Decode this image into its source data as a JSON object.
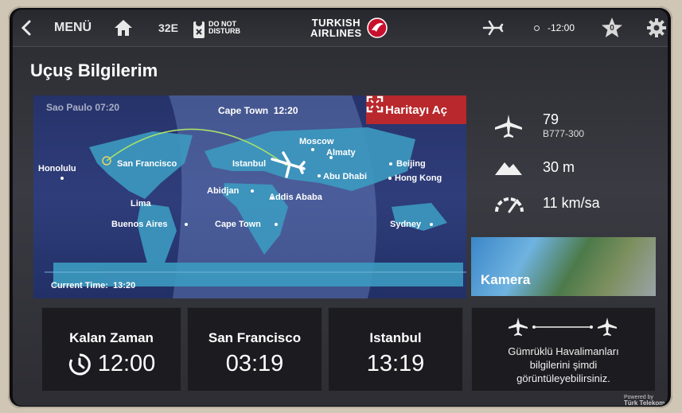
{
  "header": {
    "back_icon": "chevron-left-icon",
    "menu_label": "MENÜ",
    "home_icon": "home-icon",
    "seat": "32E",
    "dnd_line1": "DO NOT",
    "dnd_line2": "DISTURB",
    "brand_line1": "TURKISH",
    "brand_line2": "AIRLINES",
    "flight_mode_icon": "airplane-icon",
    "time_offset": "-12:00",
    "favorites_count": "0",
    "settings_icon": "gear-icon"
  },
  "page_title": "Uçuş Bilgilerim",
  "map": {
    "open_map_label": "Haritayı Aç",
    "left_time_city": "Sao Paulo",
    "left_time": "07:20",
    "center_time_city": "Cape Town",
    "center_time": "12:20",
    "current_time_label": "Current Time:",
    "current_time": "13:20",
    "cities": {
      "honolulu": "Honolulu",
      "san_francisco": "San Francisco",
      "moscow": "Moscow",
      "istanbul": "Istanbul",
      "almaty": "Almaty",
      "beijing": "Beijing",
      "abu_dhabi": "Abu Dhabi",
      "hong_kong": "Hong Kong",
      "abidjan": "Abidjan",
      "addis_ababa": "Addis Ababa",
      "lima": "Lima",
      "buenos_aires": "Buenos Aires",
      "cape_town": "Cape Town",
      "sydney": "Sydney"
    }
  },
  "flight_info": {
    "altitude_ft_label": "79",
    "aircraft": "B777-300",
    "altitude": "30 m",
    "speed": "11 km/sa"
  },
  "camera_label": "Kamera",
  "tiles": {
    "remaining_label": "Kalan Zaman",
    "remaining_value": "12:00",
    "origin_label": "San Francisco",
    "origin_time": "03:19",
    "destination_label": "Istanbul",
    "destination_time": "13:19",
    "customs_line1": "Gümrüklü Havalimanları",
    "customs_line2": "bilgilerini şimdi",
    "customs_line3": "görüntüleyebilirsiniz."
  },
  "powered_by": "Powered by",
  "telecom": "Türk Telekom",
  "colors": {
    "accent_red": "#b8282c",
    "map_ocean": "#2f3d7b",
    "map_land": "#3c9ac0",
    "route": "#a8e26a"
  }
}
